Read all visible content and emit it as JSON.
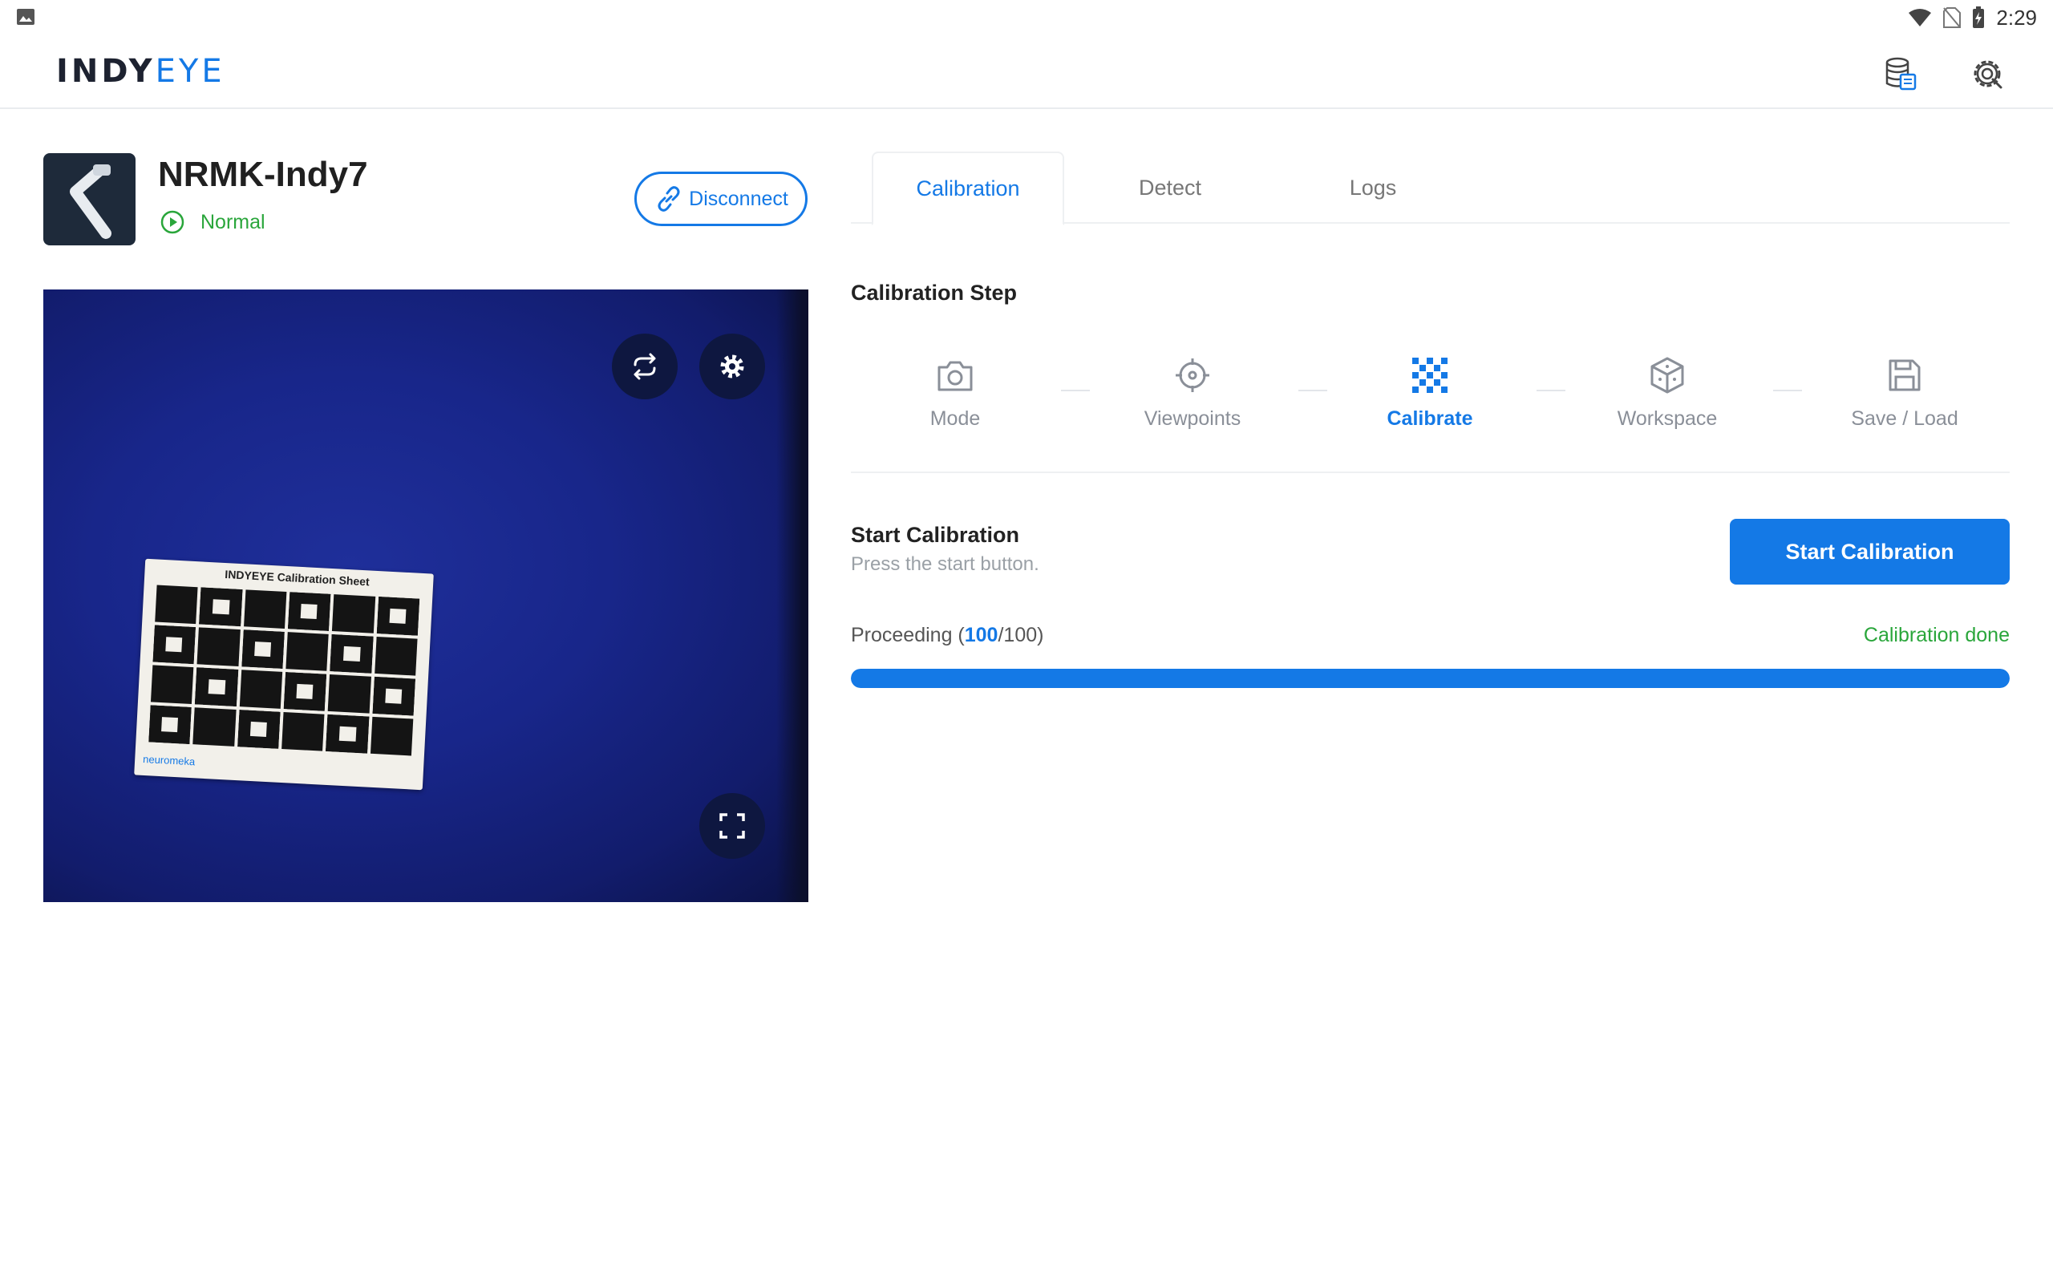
{
  "status_bar": {
    "time": "2:29"
  },
  "header": {
    "logo_part1": "INDY",
    "logo_part2": "EYE"
  },
  "robot": {
    "name": "NRMK-Indy7",
    "status": "Normal",
    "disconnect_label": "Disconnect"
  },
  "camera": {
    "sheet_title": "INDYEYE Calibration Sheet",
    "sheet_brand": "neuromeka"
  },
  "tabs": [
    {
      "label": "Calibration",
      "active": true
    },
    {
      "label": "Detect",
      "active": false
    },
    {
      "label": "Logs",
      "active": false
    }
  ],
  "calibration_step": {
    "title": "Calibration Step",
    "steps": [
      {
        "label": "Mode",
        "icon": "camera-icon"
      },
      {
        "label": "Viewpoints",
        "icon": "crosshair-icon"
      },
      {
        "label": "Calibrate",
        "icon": "checkerboard-icon",
        "active": true
      },
      {
        "label": "Workspace",
        "icon": "cube-icon"
      },
      {
        "label": "Save / Load",
        "icon": "save-icon"
      }
    ]
  },
  "start_calibration": {
    "title": "Start Calibration",
    "subtitle": "Press the start button.",
    "button_label": "Start Calibration"
  },
  "progress": {
    "label_prefix": "Proceeding (",
    "current": "100",
    "total_suffix": "/100)",
    "status": "Calibration done",
    "fraction": 1.0
  },
  "colors": {
    "accent": "#1479e6",
    "success": "#2aa63b"
  }
}
